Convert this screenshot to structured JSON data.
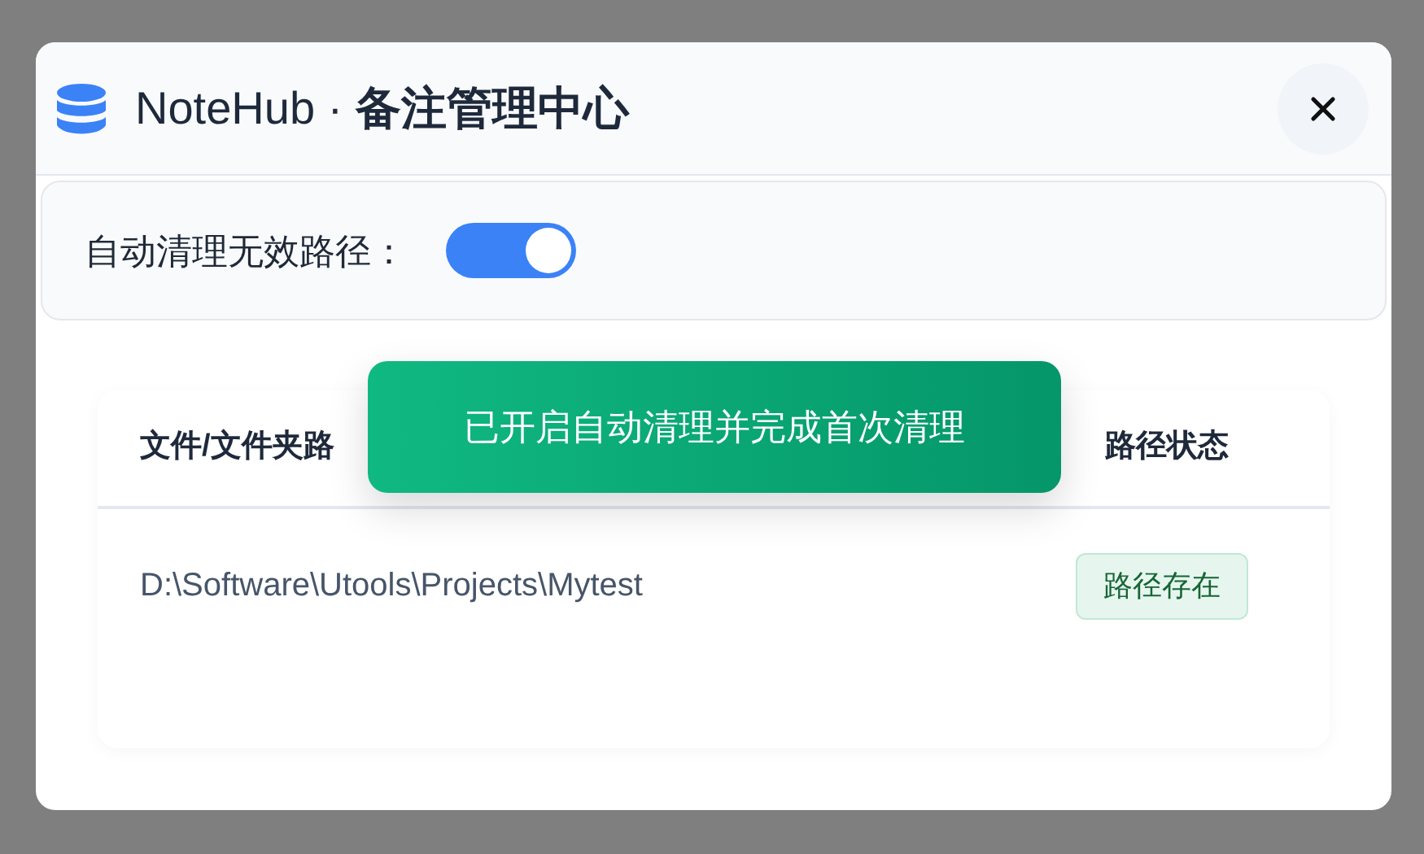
{
  "dialog": {
    "title": "NoteHub · **备注管理中心**"
  },
  "settings": {
    "auto_clean": {
      "label": "自动清理无效路径：",
      "on": true
    }
  },
  "table": {
    "columns": [
      "文件/文件夹路",
      "路径状态"
    ],
    "rows": [
      {
        "path": "D:\\Software\\Utools\\Projects\\Mytest",
        "status": "路径存在",
        "kind": "ok"
      }
    ]
  },
  "toast": {
    "text": "已开启自动清理并完成首次清理"
  }
}
